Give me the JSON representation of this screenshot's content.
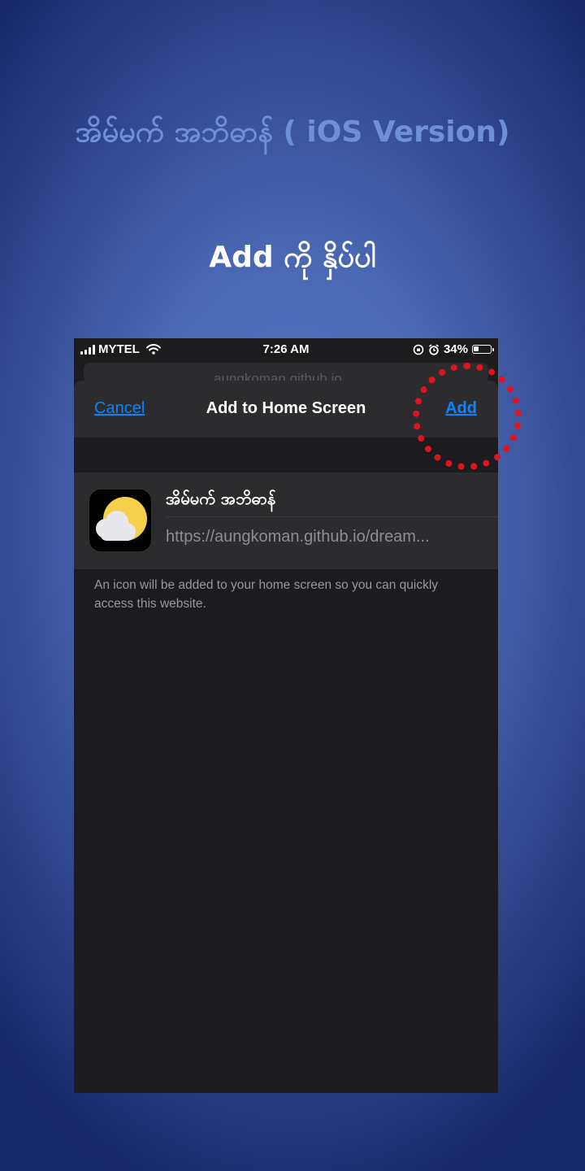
{
  "slide": {
    "title": "အိမ်မက် အဘိဓာန် ( iOS Version)",
    "instruction": "Add ကို နှိပ်ပါ"
  },
  "status_bar": {
    "carrier": "MYTEL",
    "time": "7:26 AM",
    "battery": "34%",
    "battery_level": 0.34,
    "icons": [
      "signal-icon",
      "wifi-icon",
      "orientation-lock-icon",
      "alarm-icon",
      "battery-icon"
    ]
  },
  "browser": {
    "url_peek": "aungkoman.github.io"
  },
  "sheet": {
    "cancel_label": "Cancel",
    "title": "Add to Home Screen",
    "add_label": "Add",
    "app_name": "အိမ်မက် အဘိဓာန်",
    "app_url": "https://aungkoman.github.io/dream...",
    "helper_text": "An icon will be added to your home screen so you can quickly access this website."
  },
  "colors": {
    "accent": "#0a84ff",
    "highlight": "#e0141e",
    "sun": "#f6d04d",
    "title_blue": "#6f90d6"
  }
}
